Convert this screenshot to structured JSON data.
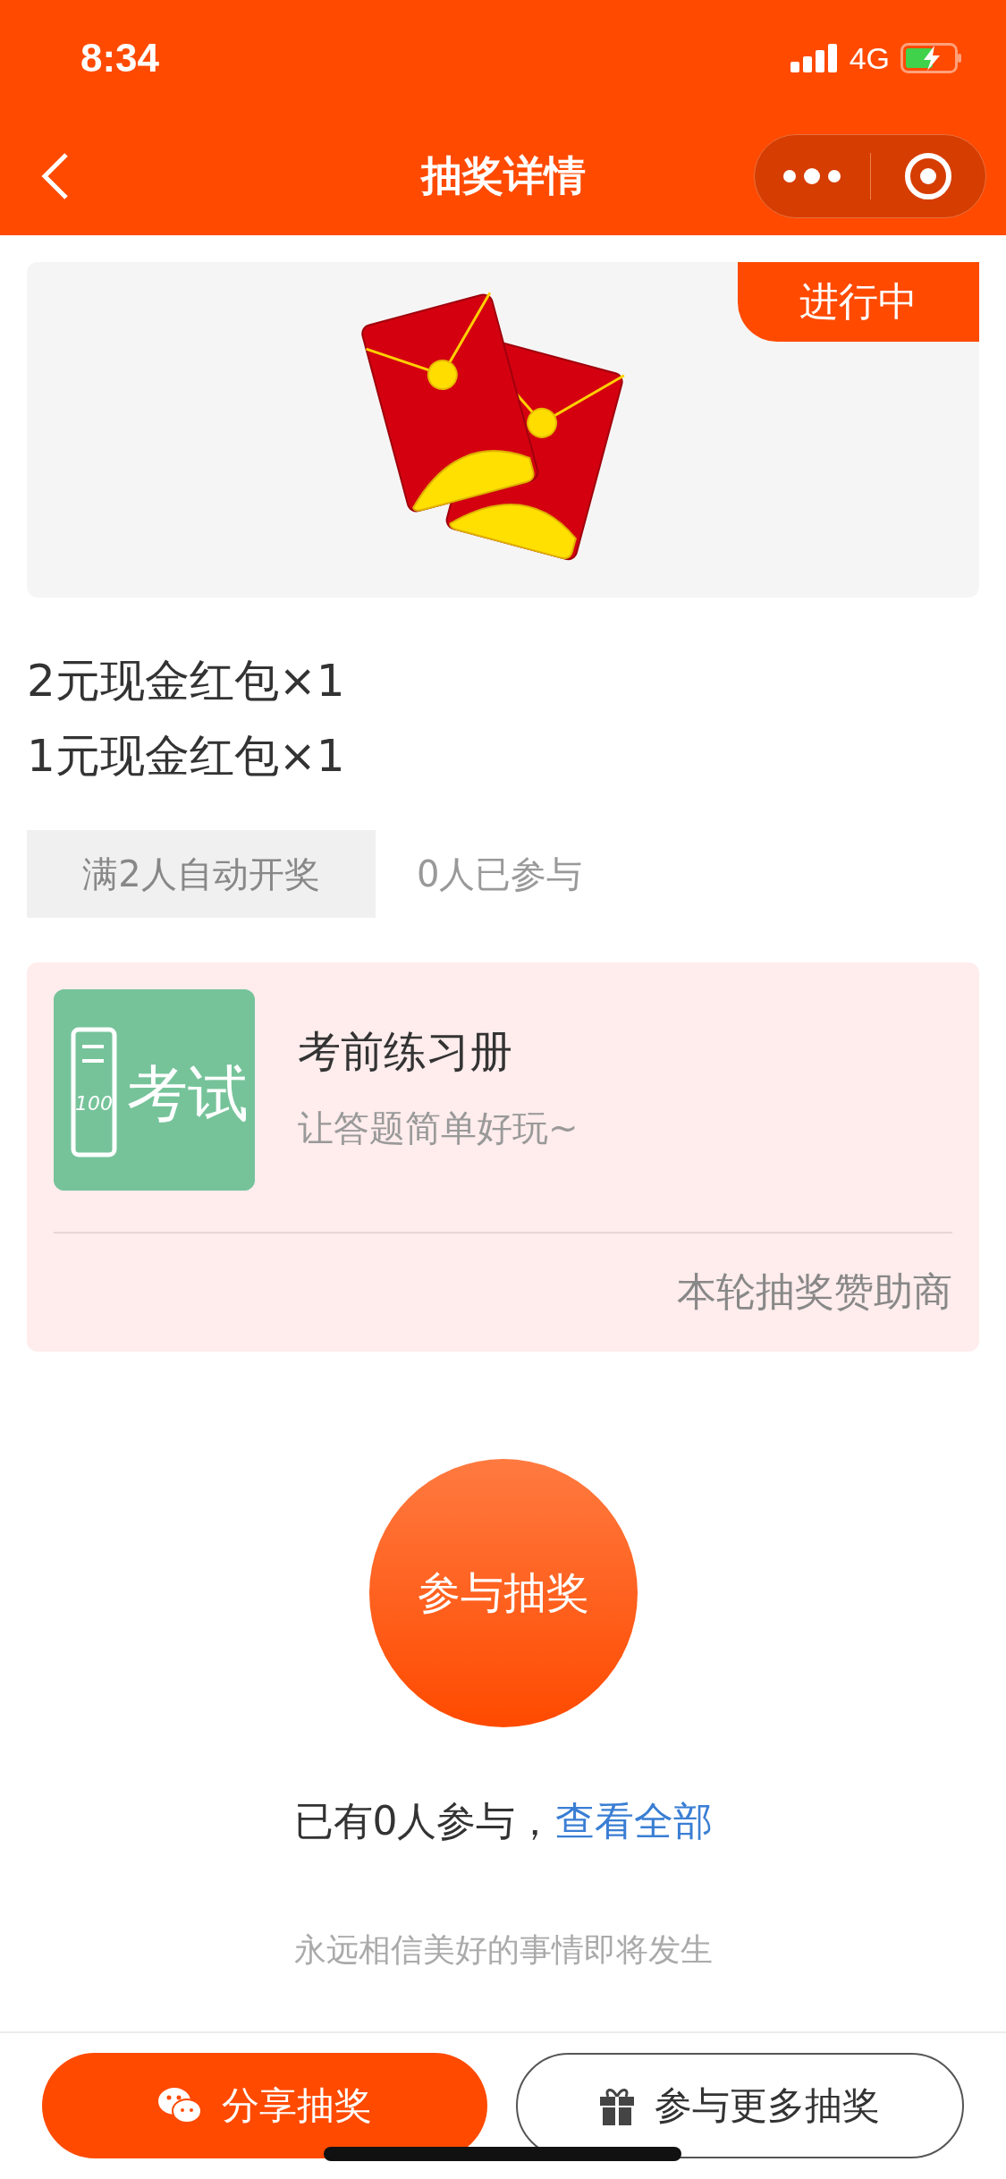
{
  "status_bar": {
    "time": "8:34",
    "network": "4G"
  },
  "nav": {
    "title": "抽奖详情"
  },
  "banner": {
    "badge": "进行中"
  },
  "prizes": [
    "2元现金红包×1",
    "1元现金红包×1"
  ],
  "condition": {
    "tag": "满2人自动开奖",
    "count": "0人已参与"
  },
  "sponsor": {
    "logo_text": "考试",
    "logo_score": "100",
    "name": "考前练习册",
    "slogan": "让答题简单好玩~",
    "label": "本轮抽奖赞助商"
  },
  "join_button": "参与抽奖",
  "participants": {
    "text": "已有0人参与，",
    "link": "查看全部"
  },
  "footer_note": "永远相信美好的事情即将发生",
  "bottom_buttons": [
    {
      "kind": "share",
      "label": "分享抽奖"
    },
    {
      "kind": "gift",
      "label": "参与更多抽奖"
    }
  ]
}
